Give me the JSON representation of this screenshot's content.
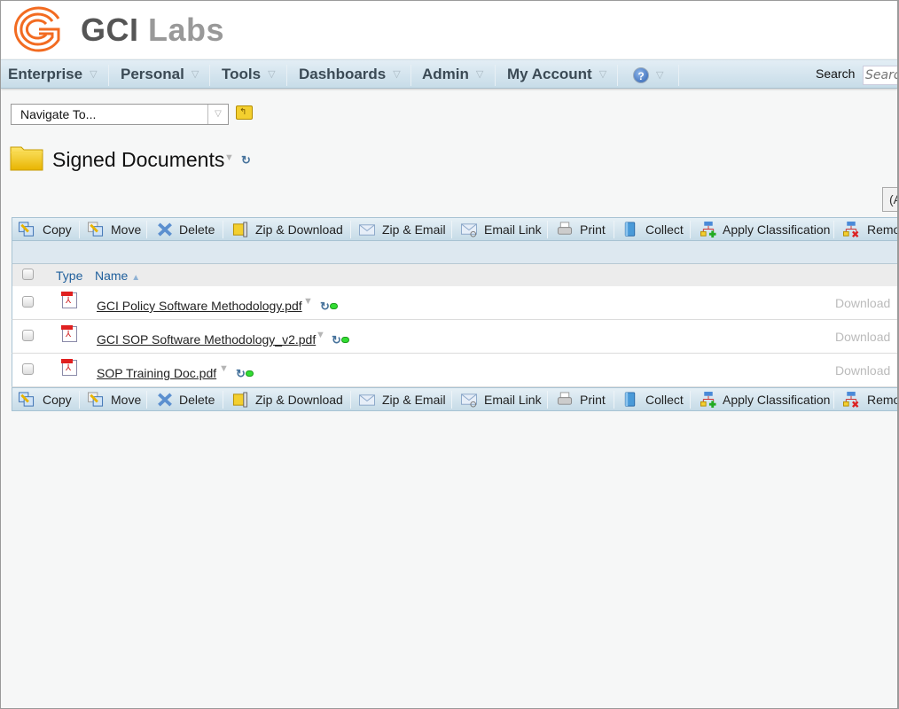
{
  "brand": {
    "name_part1": "GCI",
    "name_part2": "Labs",
    "accent": "#f26b21"
  },
  "nav": {
    "items": [
      "Enterprise",
      "Personal",
      "Tools",
      "Dashboards",
      "Admin",
      "My Account"
    ],
    "help_icon": "help-icon",
    "search_label": "Search",
    "search_placeholder": "Search"
  },
  "navigate": {
    "value": "Navigate To..."
  },
  "folder": {
    "title": "Signed Documents"
  },
  "partial_button": "(A",
  "toolbar": {
    "items": [
      {
        "label": "Copy",
        "icon": "copy-icon"
      },
      {
        "label": "Move",
        "icon": "move-icon"
      },
      {
        "label": "Delete",
        "icon": "delete-icon"
      },
      {
        "label": "Zip & Download",
        "icon": "zip-download-icon"
      },
      {
        "label": "Zip & Email",
        "icon": "zip-email-icon"
      },
      {
        "label": "Email Link",
        "icon": "email-link-icon"
      },
      {
        "label": "Print",
        "icon": "print-icon"
      },
      {
        "label": "Collect",
        "icon": "collect-icon"
      },
      {
        "label": "Apply Classification",
        "icon": "apply-classification-icon"
      },
      {
        "label": "Remov",
        "icon": "remove-classification-icon"
      }
    ]
  },
  "table": {
    "columns": [
      "Type",
      "Name"
    ],
    "sort": "Name ascending",
    "rows": [
      {
        "name": "GCI Policy Software Methodology.pdf",
        "type": "pdf",
        "action": "Download"
      },
      {
        "name": "GCI SOP Software Methodology_v2.pdf",
        "type": "pdf",
        "action": "Download"
      },
      {
        "name": "SOP Training Doc.pdf",
        "type": "pdf",
        "action": "Download"
      }
    ]
  }
}
